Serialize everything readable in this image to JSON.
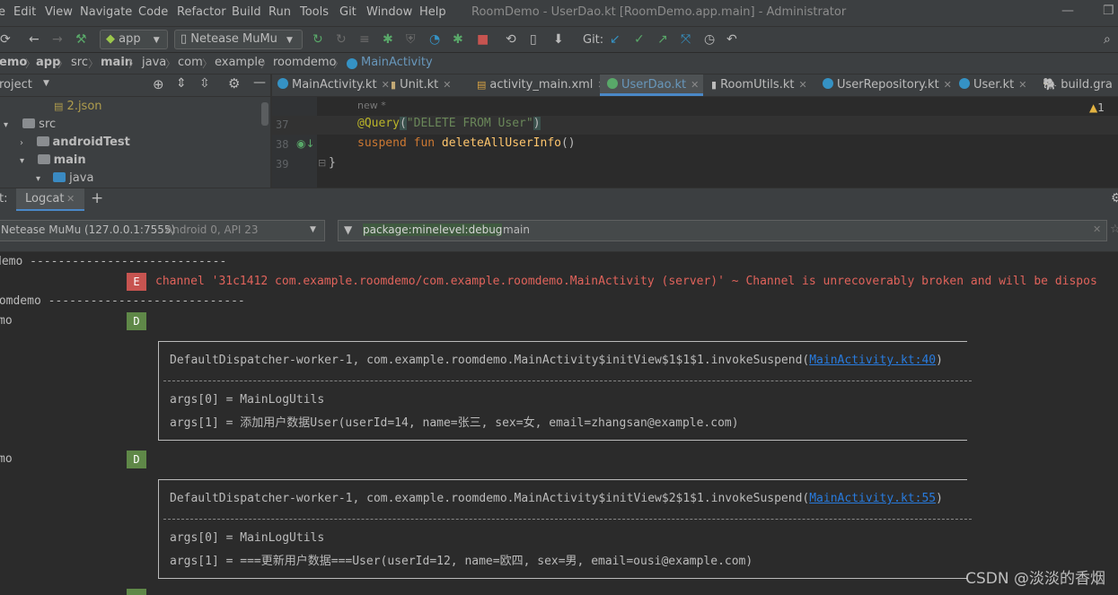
{
  "menu": {
    "items": [
      "Edit",
      "View",
      "Navigate",
      "Code",
      "Refactor",
      "Build",
      "Run",
      "Tools",
      "Git",
      "Window",
      "Help"
    ],
    "window_title": "RoomDemo - UserDao.kt [RoomDemo.app.main] - Administrator"
  },
  "toolbar": {
    "config": "app",
    "device": "Netease MuMu",
    "git_label": "Git:"
  },
  "breadcrumb": [
    "emo",
    "app",
    "src",
    "main",
    "java",
    "com",
    "example",
    "roomdemo",
    "MainActivity"
  ],
  "project": {
    "title": "roject",
    "tree": [
      {
        "label": "2.json"
      },
      {
        "label": "src"
      },
      {
        "label": "androidTest"
      },
      {
        "label": "main"
      },
      {
        "label": "java"
      }
    ]
  },
  "editor": {
    "tabs": [
      "MainActivity.kt",
      "Unit.kt",
      "activity_main.xml",
      "UserDao.kt",
      "RoomUtils.kt",
      "UserRepository.kt",
      "User.kt",
      "build.gra"
    ],
    "active_tab": "UserDao.kt",
    "hint": "new *",
    "warnings": "1",
    "lines": [
      {
        "num": "37",
        "annotation": "@Query",
        "paren_open": "(",
        "string": "\"DELETE FROM User\"",
        "paren_close": ")"
      },
      {
        "num": "38",
        "kw": "suspend fun ",
        "fn": "deleteAllUserInfo",
        "rest": "()"
      },
      {
        "num": "39",
        "text": "}"
      }
    ]
  },
  "logcat": {
    "tab_prefix": "t:",
    "tab_label": "Logcat",
    "device": "Netease MuMu (127.0.0.1:7555)",
    "device_detail": "Android 0, API 23",
    "filter": {
      "tag1": "package:mine",
      "tag2": "level:debug",
      "rest": "main"
    },
    "entries": [
      {
        "prefix": "demo ----------------------------"
      },
      {
        "level": "E",
        "text": "channel '31c1412 com.example.roomdemo/com.example.roomdemo.MainActivity (server)' ~ Channel is unrecoverably broken and will be dispos"
      },
      {
        "prefix": "oomdemo ----------------------------"
      },
      {
        "prefix": "mo",
        "level": "D"
      },
      {
        "thread": "DefaultDispatcher-worker-1, com.example.roomdemo.MainActivity$initView$1$1$1.invokeSuspend(",
        "link": "MainActivity.kt:40",
        "close": ")",
        "args0": "args[0] = MainLogUtils",
        "args1": "args[1] = 添加用户数据User(userId=14, name=张三, sex=女, email=zhangsan@example.com)"
      },
      {
        "prefix": "mo",
        "level": "D"
      },
      {
        "thread": "DefaultDispatcher-worker-1, com.example.roomdemo.MainActivity$initView$2$1$1.invokeSuspend(",
        "link": "MainActivity.kt:55",
        "close": ")",
        "args0": "args[0] = MainLogUtils",
        "args1": "args[1] = ===更新用户数据===User(userId=12, name=欧四, sex=男, email=ousi@example.com)"
      }
    ]
  },
  "watermark": "CSDN @淡淡的香烟",
  "colors": {
    "error": "#c75450",
    "debug": "#5f8848",
    "accent": "#4a88c7",
    "link": "#287bde"
  }
}
